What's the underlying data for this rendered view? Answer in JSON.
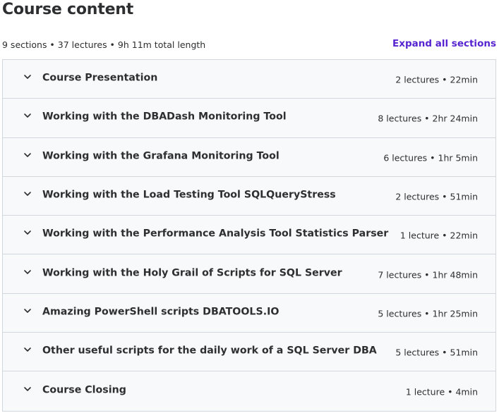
{
  "header": {
    "title": "Course content",
    "summary": "9 sections • 37 lectures • 9h 11m total length",
    "expand_all_label": "Expand all sections"
  },
  "sections": [
    {
      "title": "Course Presentation",
      "meta": "2 lectures • 22min"
    },
    {
      "title": "Working with the DBADash Monitoring Tool",
      "meta": "8 lectures • 2hr 24min"
    },
    {
      "title": "Working with the Grafana Monitoring Tool",
      "meta": "6 lectures • 1hr 5min"
    },
    {
      "title": "Working with the Load Testing Tool SQLQueryStress",
      "meta": "2 lectures • 51min"
    },
    {
      "title": "Working with the Performance Analysis Tool Statistics Parser",
      "meta": "1 lecture • 22min"
    },
    {
      "title": "Working with the Holy Grail of Scripts for SQL Server",
      "meta": "7 lectures • 1hr 48min"
    },
    {
      "title": "Amazing PowerShell scripts DBATOOLS.IO",
      "meta": "5 lectures • 1hr 25min"
    },
    {
      "title": "Other useful scripts for the daily work of a SQL Server DBA",
      "meta": "5 lectures • 51min"
    },
    {
      "title": "Course Closing",
      "meta": "1 lecture • 4min"
    }
  ],
  "icons": {
    "section_toggle": "chevron-down-icon"
  },
  "colors": {
    "accent": "#5624d0",
    "text": "#2d2f31",
    "section_bg": "#f7f9fa",
    "border": "#d1d7dc"
  }
}
